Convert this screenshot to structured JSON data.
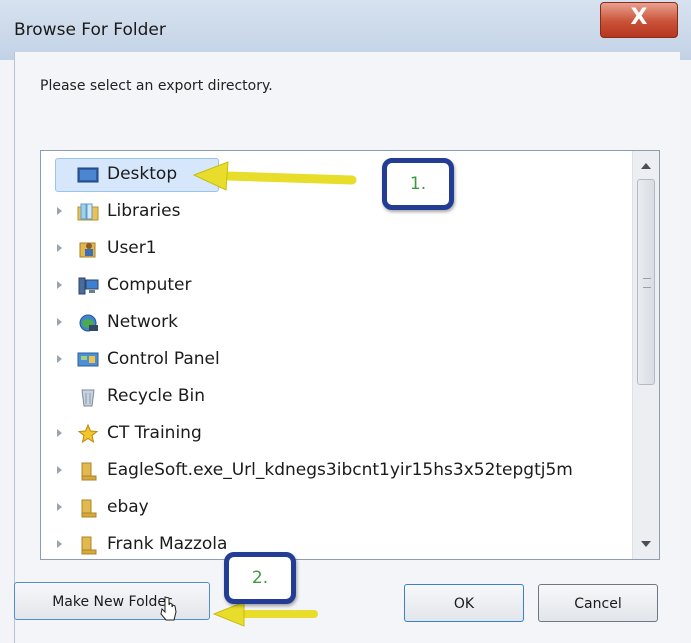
{
  "window": {
    "title": "Browse For Folder",
    "close_glyph": "X"
  },
  "prompt": "Please select an export directory.",
  "tree": {
    "items": [
      {
        "label": "Desktop",
        "icon": "desktop-icon",
        "selected": true
      },
      {
        "label": "Libraries",
        "icon": "libraries-icon"
      },
      {
        "label": "User1",
        "icon": "user-folder-icon"
      },
      {
        "label": "Computer",
        "icon": "computer-icon"
      },
      {
        "label": "Network",
        "icon": "network-icon"
      },
      {
        "label": "Control Panel",
        "icon": "control-panel-icon"
      },
      {
        "label": "Recycle Bin",
        "icon": "recycle-bin-icon"
      },
      {
        "label": "CT Training",
        "icon": "star-folder-icon"
      },
      {
        "label": "EagleSoft.exe_Url_kdnegs3ibcnt1yir15hs3x52tepgtj5m",
        "icon": "folder-icon"
      },
      {
        "label": "ebay",
        "icon": "folder-icon"
      },
      {
        "label": "Frank Mazzola",
        "icon": "folder-icon"
      }
    ]
  },
  "buttons": {
    "make_new_folder": "Make New Folder",
    "ok": "OK",
    "cancel": "Cancel"
  },
  "annotations": {
    "callout_1": "1.",
    "callout_2": "2."
  },
  "colors": {
    "selection": "#d6e7fb",
    "callout_border": "#233d95",
    "callout_text": "#3f9a3f",
    "arrow": "#e8dd2a"
  }
}
